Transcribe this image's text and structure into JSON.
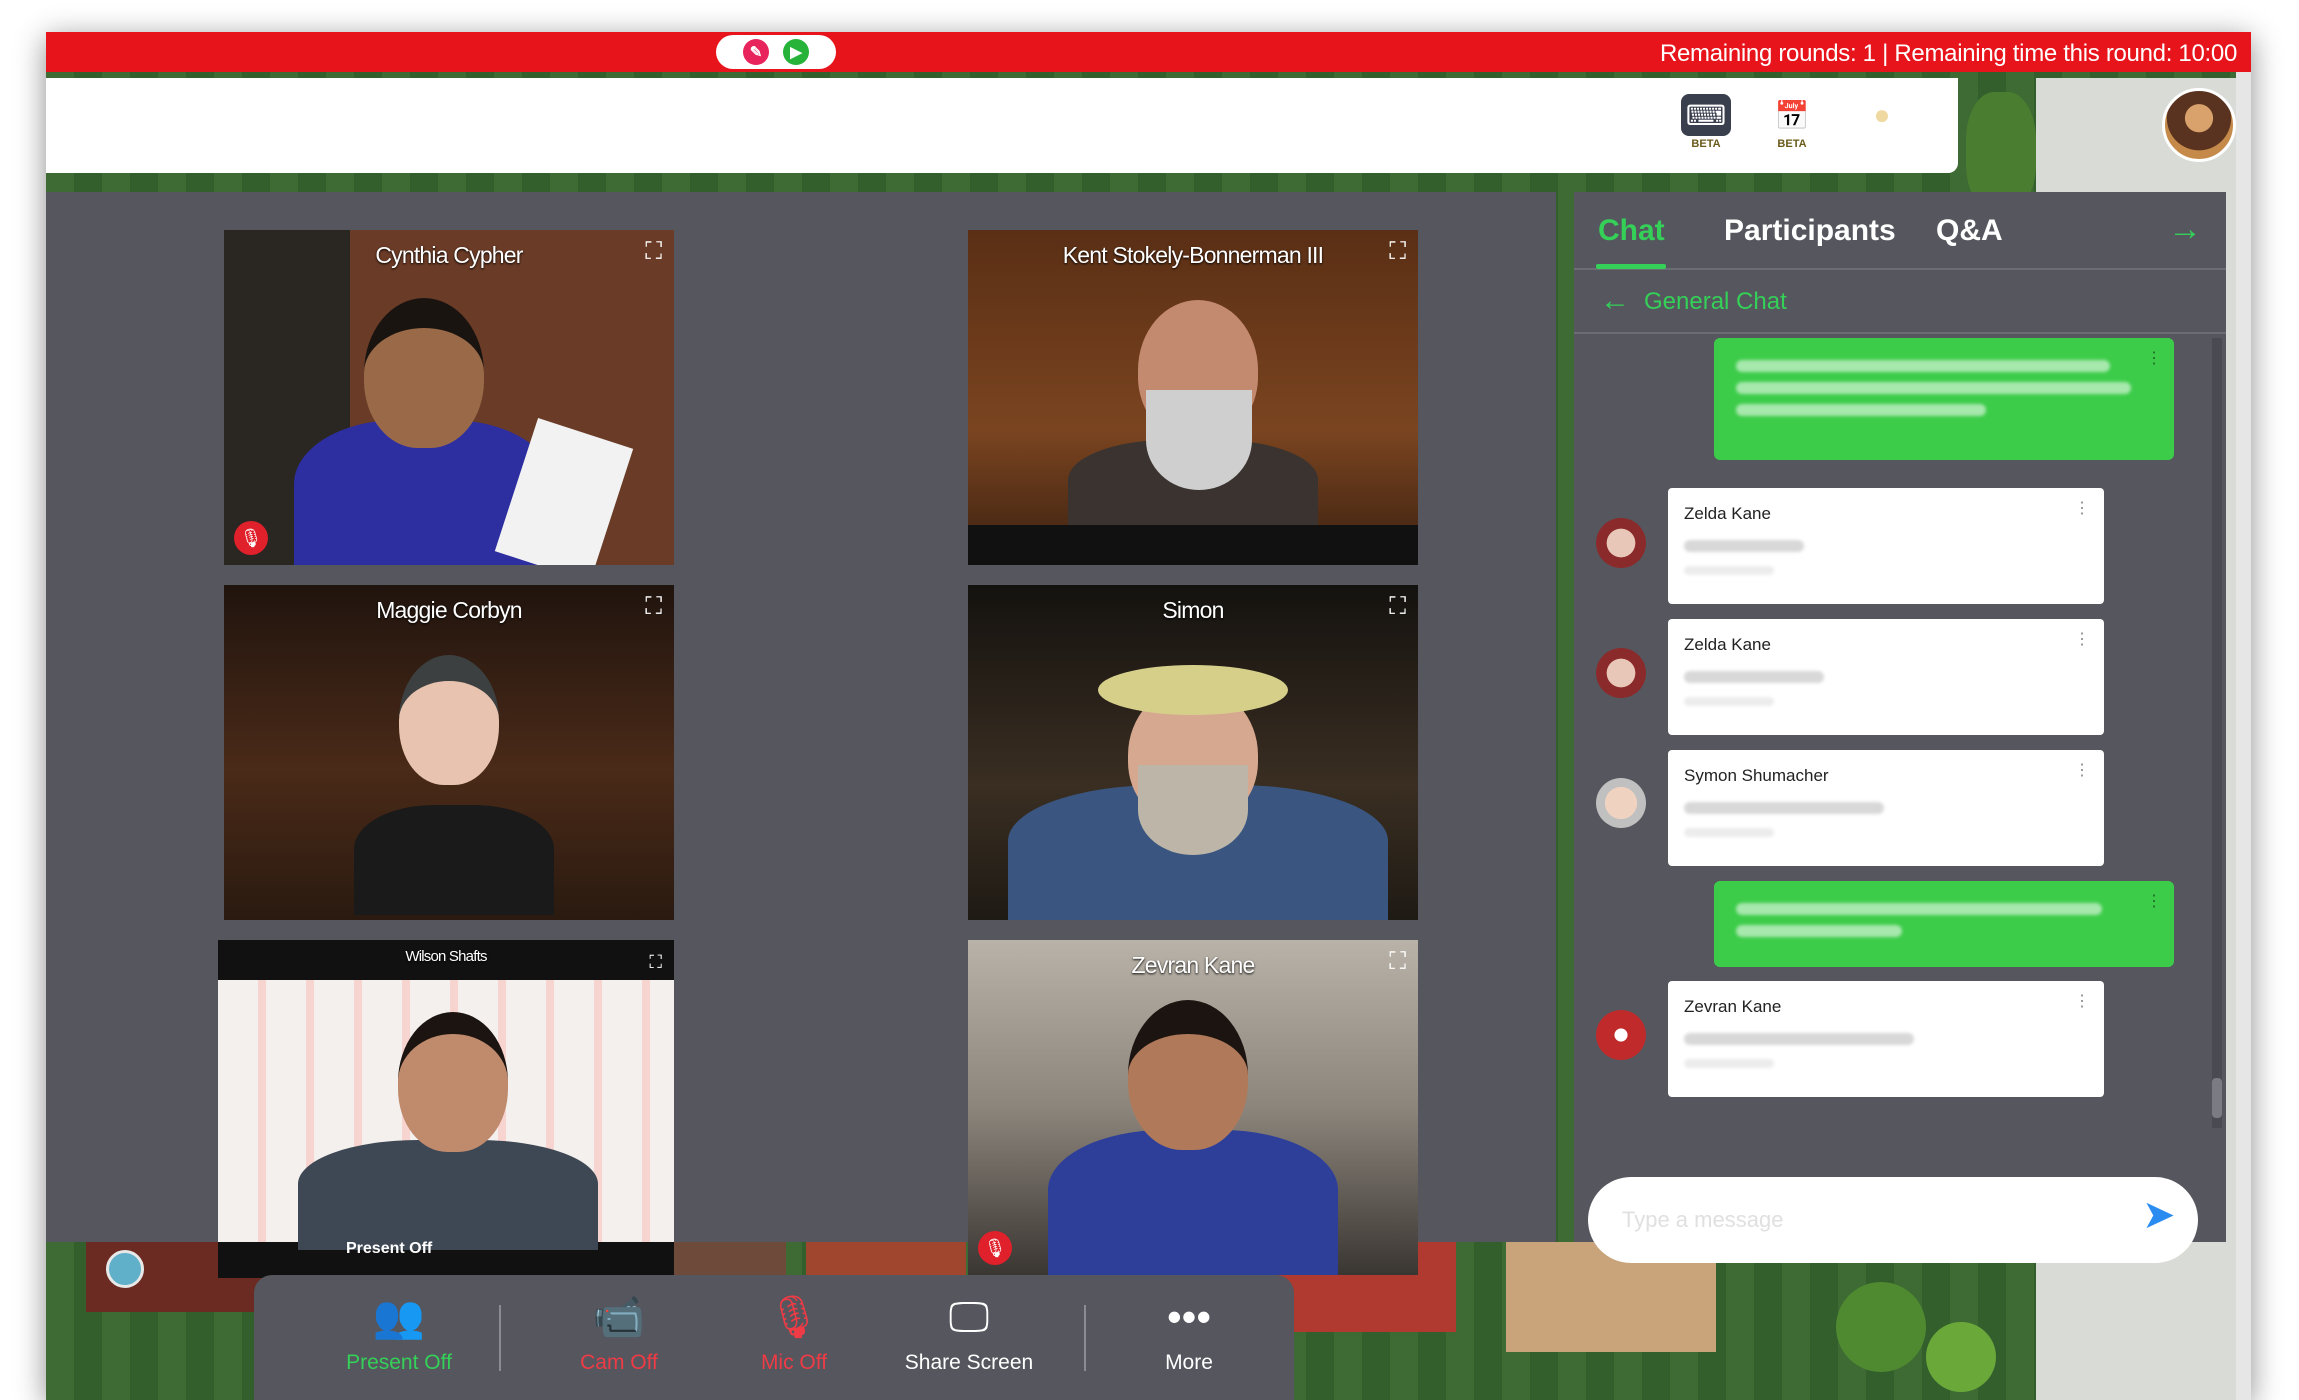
{
  "top_bar": {
    "status": "Remaining rounds: 1 | Remaining time this round: 10:00",
    "pill_colors": [
      "#e8245c",
      "#27b33a"
    ]
  },
  "toolbar": {
    "icons": [
      {
        "name": "whiteboard-beta-icon",
        "label": "BETA"
      },
      {
        "name": "calendar-beta-icon",
        "label": "BETA"
      },
      {
        "name": "egg-icon",
        "label": ""
      }
    ]
  },
  "video_tiles": [
    {
      "name": "Cynthia Cypher",
      "muted": true
    },
    {
      "name": "Kent Stokely-Bonnerman III",
      "muted": false
    },
    {
      "name": "Maggie Corbyn",
      "muted": false
    },
    {
      "name": "Simon",
      "muted": false
    },
    {
      "name": "Wilson Shafts",
      "muted": false
    },
    {
      "name": "Zevran Kane",
      "muted": true
    }
  ],
  "map_label": "Present Off",
  "chat": {
    "tabs": [
      "Chat",
      "Participants",
      "Q&A"
    ],
    "active_tab": "Chat",
    "channel": "General Chat",
    "messages": [
      {
        "sender": "",
        "outgoing": true
      },
      {
        "sender": "Zelda Kane",
        "outgoing": false
      },
      {
        "sender": "Zelda Kane",
        "outgoing": false
      },
      {
        "sender": "Symon Shumacher",
        "outgoing": false
      },
      {
        "sender": "",
        "outgoing": true
      },
      {
        "sender": "Zevran Kane",
        "outgoing": false
      }
    ],
    "input_placeholder": "Type a message"
  },
  "controls": [
    {
      "label": "Present Off",
      "icon": "present-icon",
      "color": "#34d058"
    },
    {
      "label": "Cam Off",
      "icon": "camera-off-icon",
      "color": "#ef3b45"
    },
    {
      "label": "Mic Off",
      "icon": "mic-off-icon",
      "color": "#ef3b45"
    },
    {
      "label": "Share Screen",
      "icon": "screen-share-icon",
      "color": "#ffffff"
    },
    {
      "label": "More",
      "icon": "more-icon",
      "color": "#ffffff"
    }
  ]
}
